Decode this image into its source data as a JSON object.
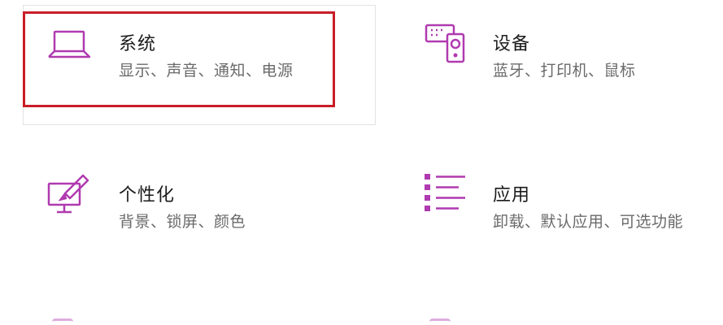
{
  "tiles": {
    "system": {
      "title": "系统",
      "subtitle": "显示、声音、通知、电源",
      "icon": "laptop-icon"
    },
    "devices": {
      "title": "设备",
      "subtitle": "蓝牙、打印机、鼠标",
      "icon": "devices-icon"
    },
    "personalization": {
      "title": "个性化",
      "subtitle": "背景、锁屏、颜色",
      "icon": "personalization-icon"
    },
    "apps": {
      "title": "应用",
      "subtitle": "卸载、默认应用、可选功能",
      "icon": "apps-list-icon"
    }
  },
  "colors": {
    "icon_accent": "#b03ab0",
    "highlight_border": "#c81e28",
    "title_text": "#1b1b1b",
    "subtitle_text": "#6a6a6a"
  }
}
